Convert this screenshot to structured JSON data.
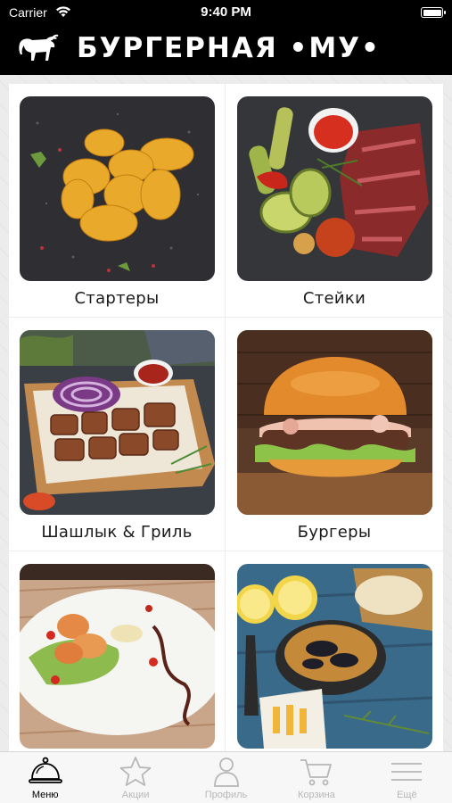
{
  "status": {
    "carrier": "Carrier",
    "time": "9:40 PM",
    "battery_level": 1.0
  },
  "header": {
    "brand": "БУРГЕРНАЯ •МУ•"
  },
  "categories": [
    {
      "label": "Стартеры"
    },
    {
      "label": "Стейки"
    },
    {
      "label": "Шашлык & Гриль"
    },
    {
      "label": "Бургеры"
    },
    {
      "label": ""
    },
    {
      "label": ""
    }
  ],
  "tabs": [
    {
      "label": "Меню",
      "icon": "cloche-icon",
      "active": true
    },
    {
      "label": "Акции",
      "icon": "star-icon",
      "active": false
    },
    {
      "label": "Профиль",
      "icon": "person-icon",
      "active": false
    },
    {
      "label": "Корзина",
      "icon": "cart-icon",
      "active": false
    },
    {
      "label": "Ещё",
      "icon": "menu-lines-icon",
      "active": false
    }
  ],
  "colors": {
    "header_bg": "#000000",
    "tab_active": "#000000",
    "tab_inactive": "#b7b7b7"
  }
}
